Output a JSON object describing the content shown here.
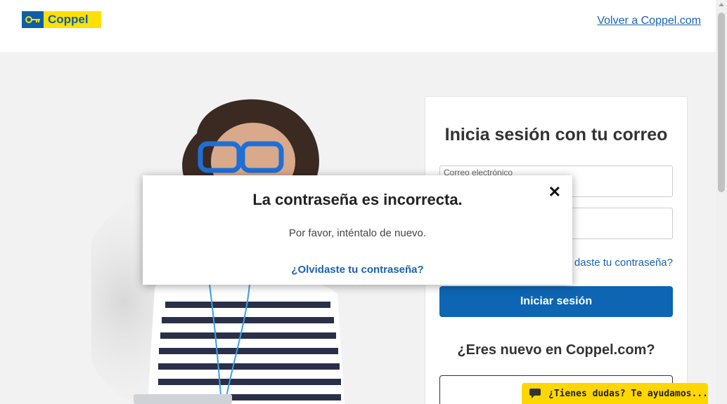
{
  "header": {
    "logo_text": "Coppel",
    "back_link": "Volver a Coppel.com"
  },
  "login": {
    "title": "Inicia sesión con tu correo",
    "email_label": "Correo electrónico",
    "forgot_partial": "daste tu contraseña?",
    "submit_label": "Iniciar sesión",
    "new_user_title": "¿Eres nuevo en Coppel.com?"
  },
  "modal": {
    "title": "La contraseña es incorrecta.",
    "close": "✕",
    "message": "Por favor, inténtalo de nuevo.",
    "forgot_link": "¿Olvidaste tu contraseña?"
  },
  "chat": {
    "label": "¿Tienes dudas? Te ayudamos..."
  },
  "colors": {
    "brand_blue": "#0d65b3",
    "brand_yellow": "#ffe000",
    "link": "#1a63b0"
  }
}
